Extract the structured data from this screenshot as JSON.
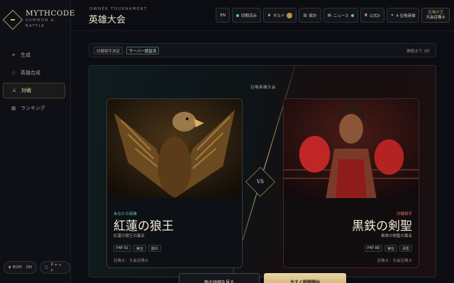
{
  "brand": {
    "name": "MYTHCODE",
    "tagline": "SUMMON & BATTLE"
  },
  "sidebar": {
    "items": [
      {
        "label": "生成",
        "icon": "sparkle-icon",
        "glyph": "✦"
      },
      {
        "label": "英雄合成",
        "icon": "diamond-icon",
        "glyph": "◇"
      },
      {
        "label": "対戦",
        "icon": "crossed-swords-icon",
        "glyph": "⚔"
      },
      {
        "label": "ランキング",
        "icon": "podium-icon",
        "glyph": "▦"
      }
    ],
    "active": "対戦",
    "footer": {
      "bgm_label": "BGM",
      "bgm_state": "ON",
      "chat_label": "チャット"
    }
  },
  "header": {
    "eyebrow": "OWNER TOURNAMENT",
    "title": "英雄大会",
    "buttons": {
      "lang": "EN",
      "sync": "同期済み",
      "guild": "ギルド",
      "stats": "統計",
      "news": "ニュース",
      "official_x": "公式X",
      "summon_hero": "4 召喚英雄"
    },
    "host": {
      "line1": "召喚の王",
      "line2": "大会召喚士"
    }
  },
  "status_bar": {
    "tags": [
      "対戦相手決定",
      "サーバー認証済"
    ],
    "countdown": "開戦まで 3秒"
  },
  "arena": {
    "label": "召喚英雄大会",
    "vs": "VS",
    "left": {
      "role": "あなたの英雄",
      "name": "紅蓮の狼王",
      "alias": "紅蓮の狼王の異名",
      "chips": [
        "P4P 91",
        "実在",
        "闘炎"
      ],
      "summoner": "召喚士：大会召喚士"
    },
    "right": {
      "role": "対戦相手",
      "name": "黒鉄の剣聖",
      "alias": "黒鉄の剣聖の異名",
      "chips": [
        "P4P 88",
        "実在",
        "月影"
      ],
      "summoner": "召喚士：大会召喚士"
    }
  },
  "actions": {
    "secondary": "敵の詳細を見る",
    "primary": "今すぐ戦闘開始"
  },
  "colors": {
    "accent_gold": "#d7b46a",
    "status_green": "#5fc9a4",
    "enemy_red": "#e0736f"
  }
}
